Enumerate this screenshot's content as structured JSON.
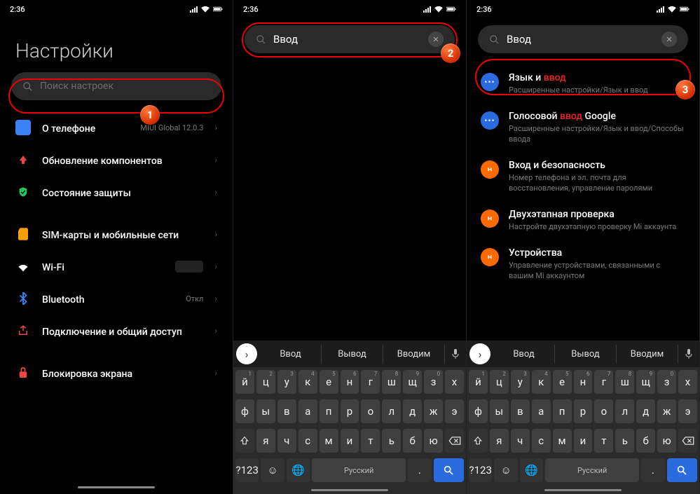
{
  "status": {
    "time": "2:36"
  },
  "panel1": {
    "title": "Настройки",
    "search_placeholder": "Поиск настроек",
    "items": [
      {
        "label": "О телефоне",
        "meta": "MIUI Global 12.0.3",
        "icon": "phone",
        "color": "#3b82f6"
      },
      {
        "label": "Обновление компонентов",
        "icon": "arrow-up",
        "color": "#ef4444"
      },
      {
        "label": "Состояние защиты",
        "icon": "shield",
        "color": "#22c55e"
      }
    ],
    "items2": [
      {
        "label": "SIM-карты и мобильные сети",
        "icon": "sim",
        "color": "#f59e0b"
      },
      {
        "label": "Wi-Fi",
        "icon": "wifi",
        "color": "#fff"
      },
      {
        "label": "Bluetooth",
        "meta": "Откл",
        "icon": "bt",
        "color": "#3b82f6"
      },
      {
        "label": "Подключение и общий доступ",
        "icon": "share",
        "color": "#ef4444"
      }
    ],
    "items3": [
      {
        "label": "Блокировка экрана",
        "icon": "lock",
        "color": "#ef4444"
      }
    ]
  },
  "panel2": {
    "search_value": "Ввод"
  },
  "panel3": {
    "search_value": "Ввод",
    "results": [
      {
        "pre": "Язык и ",
        "hl": "ввод",
        "post": "",
        "sub": "Расширенные настройки/Язык и ввод",
        "icon": "dots",
        "bg": "#2a6be0"
      },
      {
        "pre": "Голосовой ",
        "hl": "ввод",
        "post": " Google",
        "sub": "Расширенные настройки/Язык и ввод/Способы ввода",
        "icon": "dots",
        "bg": "#2a6be0"
      },
      {
        "pre": "Вход и безопасность",
        "hl": "",
        "post": "",
        "sub": "Номер телефона и эл. почта для восстановления, управление паролями",
        "icon": "mi",
        "bg": "#ff6a00"
      },
      {
        "pre": "Двухэтапная проверка",
        "hl": "",
        "post": "",
        "sub": "Настройте двухэтапную проверку Mi аккаунта",
        "icon": "mi",
        "bg": "#ff6a00"
      },
      {
        "pre": "Устройства",
        "hl": "",
        "post": "",
        "sub": "Управление устройствами, связанными с вашим Mi аккаунтом",
        "icon": "mi",
        "bg": "#ff6a00"
      }
    ]
  },
  "keyboard": {
    "suggestions": [
      "Ввод",
      "Вывод",
      "Вводим"
    ],
    "row1": [
      "й",
      "ц",
      "у",
      "к",
      "е",
      "н",
      "г",
      "ш",
      "щ",
      "з",
      "х"
    ],
    "row1sup": [
      "1",
      "2",
      "3",
      "4",
      "5",
      "6",
      "7",
      "8",
      "9",
      "0",
      ""
    ],
    "row2": [
      "ф",
      "ы",
      "в",
      "а",
      "п",
      "р",
      "о",
      "л",
      "д",
      "ж",
      "э"
    ],
    "row3": [
      "я",
      "ч",
      "с",
      "м",
      "и",
      "т",
      "ь",
      "б",
      "ю"
    ],
    "sym": "?123",
    "space": "Русский",
    "dot": "."
  },
  "badges": {
    "b1": "1",
    "b2": "2",
    "b3": "3"
  }
}
